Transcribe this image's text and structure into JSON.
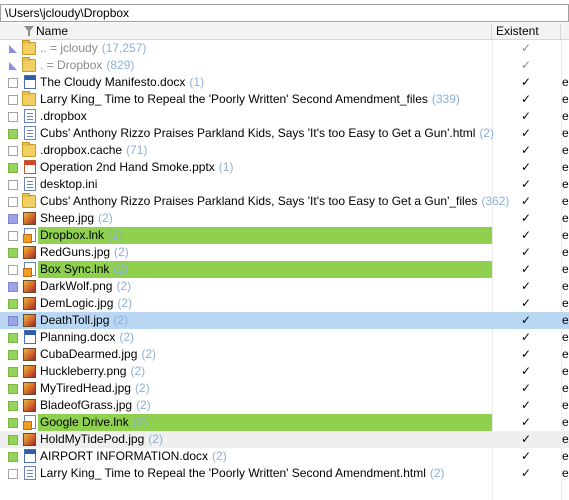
{
  "path": "\\Users\\jcloudy\\Dropbox",
  "columns": {
    "name": "Name",
    "existent": "Existent",
    "more": ""
  },
  "rows": [
    {
      "kind": "up",
      "icon": "folder",
      "name": "..  =  jcloudy",
      "count": "(17,257)",
      "exist": "✓",
      "tail": "",
      "dim": true,
      "highlight": "",
      "check": "up"
    },
    {
      "kind": "up",
      "icon": "folder",
      "name": ".   =  Dropbox",
      "count": "(829)",
      "exist": "✓",
      "tail": "",
      "dim": true,
      "highlight": "",
      "check": "up"
    },
    {
      "icon": "doc",
      "name": "The Cloudy Manifesto.docx",
      "count": "(1)",
      "exist": "✓",
      "tail": "e",
      "highlight": "",
      "check": "box"
    },
    {
      "icon": "folder",
      "name": "Larry King_ Time to Repeal the 'Poorly Written' Second Amendment_files",
      "count": "(339)",
      "exist": "✓",
      "tail": "e",
      "highlight": "",
      "check": "box"
    },
    {
      "icon": "file",
      "name": ".dropbox",
      "count": "",
      "exist": "✓",
      "tail": "e",
      "highlight": "",
      "check": "box"
    },
    {
      "icon": "file",
      "name": "Cubs' Anthony Rizzo Praises Parkland Kids, Says 'It's too Easy to Get a Gun'.html",
      "count": "(2)",
      "exist": "✓",
      "tail": "e",
      "highlight": "",
      "check": "green"
    },
    {
      "icon": "folder",
      "name": ".dropbox.cache",
      "count": "(71)",
      "exist": "✓",
      "tail": "e",
      "highlight": "",
      "check": "box"
    },
    {
      "icon": "ppt",
      "name": "Operation 2nd Hand Smoke.pptx",
      "count": "(1)",
      "exist": "✓",
      "tail": "e",
      "highlight": "",
      "check": "green"
    },
    {
      "icon": "file",
      "name": "desktop.ini",
      "count": "",
      "exist": "✓",
      "tail": "e",
      "highlight": "",
      "check": "box"
    },
    {
      "icon": "folder",
      "name": "Cubs' Anthony Rizzo Praises Parkland Kids, Says 'It's too Easy to Get a Gun'_files",
      "count": "(362)",
      "exist": "✓",
      "tail": "e",
      "highlight": "",
      "check": "box"
    },
    {
      "icon": "image",
      "name": "Sheep.jpg",
      "count": "(2)",
      "exist": "✓",
      "tail": "e",
      "highlight": "",
      "check": "violet"
    },
    {
      "icon": "link",
      "name": "Dropbox.lnk",
      "count": "(2)",
      "exist": "✓",
      "tail": "e",
      "highlight": "green",
      "check": "box"
    },
    {
      "icon": "image",
      "name": "RedGuns.jpg",
      "count": "(2)",
      "exist": "✓",
      "tail": "e",
      "highlight": "",
      "check": "green"
    },
    {
      "icon": "link",
      "name": "Box Sync.lnk",
      "count": "(2)",
      "exist": "✓",
      "tail": "e",
      "highlight": "green",
      "check": "box"
    },
    {
      "icon": "image",
      "name": "DarkWolf.png",
      "count": "(2)",
      "exist": "✓",
      "tail": "e",
      "highlight": "",
      "check": "violet"
    },
    {
      "icon": "image",
      "name": "DemLogic.jpg",
      "count": "(2)",
      "exist": "✓",
      "tail": "e",
      "highlight": "",
      "check": "green"
    },
    {
      "icon": "image",
      "name": "DeathToll.jpg",
      "count": "(2)",
      "exist": "✓",
      "tail": "e",
      "highlight": "blue",
      "check": "violet"
    },
    {
      "icon": "doc",
      "name": "Planning.docx",
      "count": "(2)",
      "exist": "✓",
      "tail": "e",
      "highlight": "",
      "check": "green"
    },
    {
      "icon": "image",
      "name": "CubaDearmed.jpg",
      "count": "(2)",
      "exist": "✓",
      "tail": "e",
      "highlight": "",
      "check": "green"
    },
    {
      "icon": "image",
      "name": "Huckleberry.png",
      "count": "(2)",
      "exist": "✓",
      "tail": "e",
      "highlight": "",
      "check": "green"
    },
    {
      "icon": "image",
      "name": "MyTiredHead.jpg",
      "count": "(2)",
      "exist": "✓",
      "tail": "e",
      "highlight": "",
      "check": "green"
    },
    {
      "icon": "image",
      "name": "BladeofGrass.jpg",
      "count": "(2)",
      "exist": "✓",
      "tail": "e",
      "highlight": "",
      "check": "green"
    },
    {
      "icon": "link",
      "name": "Google Drive.lnk",
      "count": "(2)",
      "exist": "✓",
      "tail": "e",
      "highlight": "green",
      "check": "green"
    },
    {
      "icon": "image",
      "name": "HoldMyTidePod.jpg",
      "count": "(2)",
      "exist": "✓",
      "tail": "e",
      "highlight": "gray",
      "check": "green"
    },
    {
      "icon": "doc",
      "name": "AIRPORT INFORMATION.docx",
      "count": "(2)",
      "exist": "✓",
      "tail": "e",
      "highlight": "",
      "check": "green"
    },
    {
      "icon": "file",
      "name": "Larry King_ Time to Repeal the 'Poorly Written' Second Amendment.html",
      "count": "(2)",
      "exist": "✓",
      "tail": "e",
      "highlight": "",
      "check": "box"
    }
  ],
  "colors": {
    "highlight_green": "#8fd14f",
    "selection_blue": "#b9d7f3",
    "count_blue": "#8db0d8"
  }
}
